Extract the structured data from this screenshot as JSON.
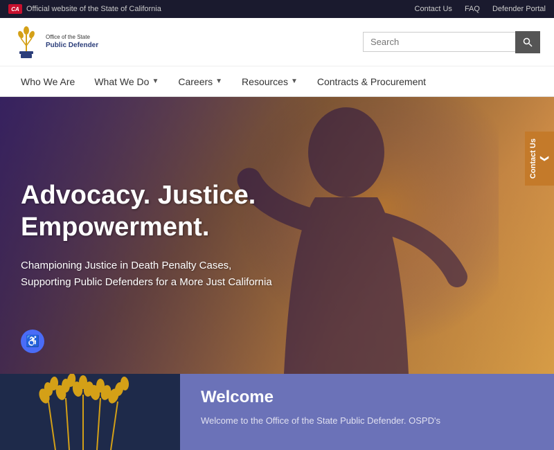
{
  "topbar": {
    "ca_logo_text": "CA",
    "official_text": "Official website of the State of California",
    "contact_us": "Contact Us",
    "faq": "FAQ",
    "defender_portal": "Defender Portal"
  },
  "header": {
    "logo": {
      "office_line1": "Office of the State",
      "office_line2": "Public Defender"
    },
    "search": {
      "placeholder": "Search",
      "button_icon": "🔍"
    }
  },
  "nav": {
    "items": [
      {
        "label": "Who We Are",
        "has_dropdown": false
      },
      {
        "label": "What We Do",
        "has_dropdown": true
      },
      {
        "label": "Careers",
        "has_dropdown": true
      },
      {
        "label": "Resources",
        "has_dropdown": true
      },
      {
        "label": "Contracts & Procurement",
        "has_dropdown": false
      }
    ]
  },
  "hero": {
    "title_line1": "Advocacy. Justice.",
    "title_line2": "Empowerment.",
    "subtitle": "Championing Justice in Death Penalty Cases, Supporting Public Defenders for a More Just California",
    "contact_tab_label": "Contact Us",
    "accessibility_icon": "♿"
  },
  "bottom": {
    "welcome_title": "Welcome",
    "welcome_text": "Welcome to the Office of the State Public Defender. OSPD's"
  }
}
